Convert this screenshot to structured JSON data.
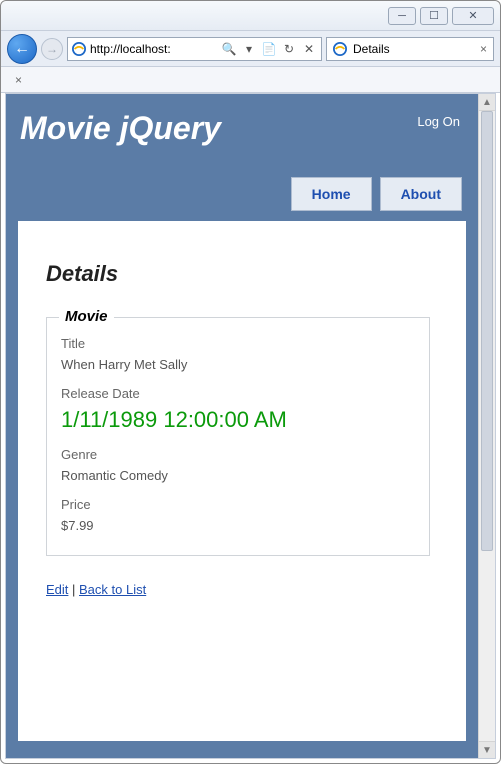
{
  "window": {
    "minimize_tip": "Minimize",
    "maximize_tip": "Maximize",
    "close_tip": "Close"
  },
  "browser": {
    "url": "http://localhost:",
    "search_glyph": "🔍",
    "dropdown_glyph": "▾",
    "refresh_glyph": "↻",
    "stop_glyph": "✕",
    "compat_glyph": "📄",
    "tab_title": "Details",
    "tab_close_glyph": "×",
    "sub_close_glyph": "×"
  },
  "header": {
    "site_title": "Movie jQuery",
    "logon_label": "Log On"
  },
  "nav": {
    "home_label": "Home",
    "about_label": "About"
  },
  "page": {
    "heading": "Details",
    "legend": "Movie",
    "fields": {
      "title_label": "Title",
      "title_value": "When Harry Met Sally",
      "release_label": "Release Date",
      "release_value": "1/11/1989 12:00:00 AM",
      "genre_label": "Genre",
      "genre_value": "Romantic Comedy",
      "price_label": "Price",
      "price_value": "$7.99"
    },
    "actions": {
      "edit_label": "Edit",
      "separator": " | ",
      "back_label": "Back to List"
    }
  }
}
